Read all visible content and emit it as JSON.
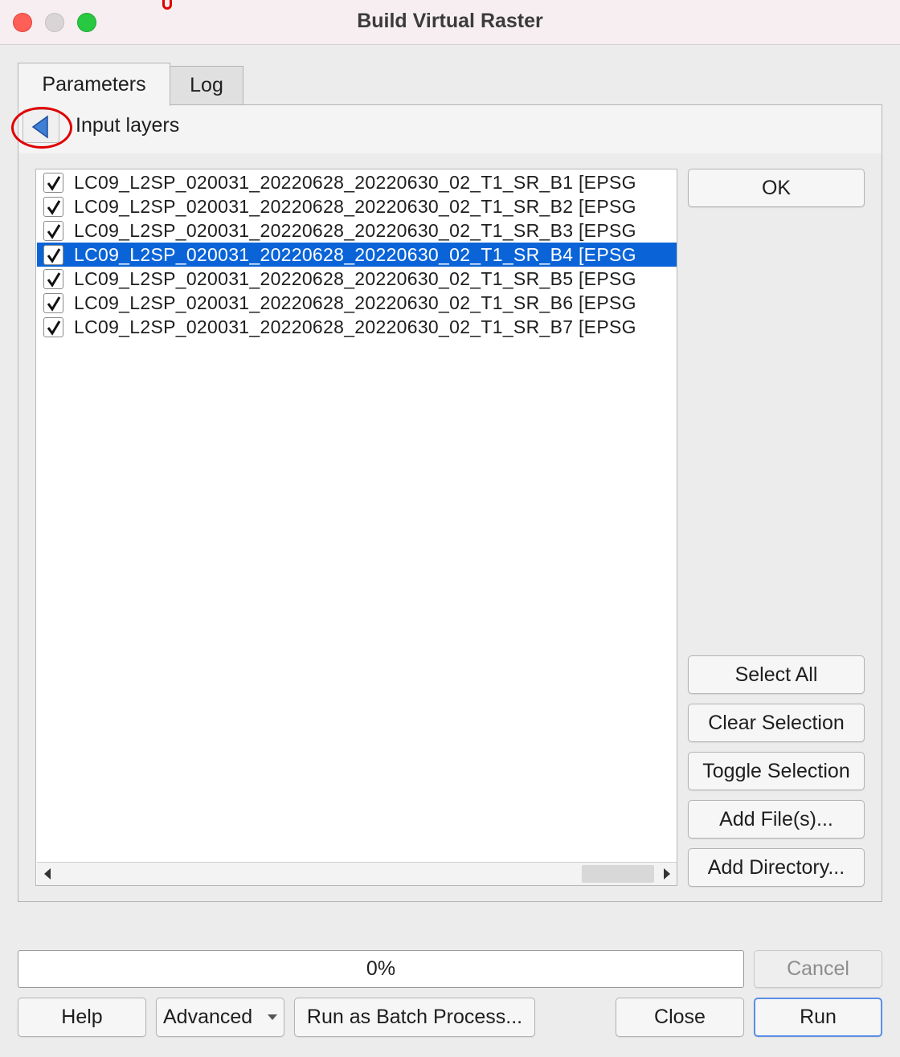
{
  "window": {
    "title": "Build Virtual Raster"
  },
  "tabs": [
    {
      "label": "Parameters"
    },
    {
      "label": "Log"
    }
  ],
  "header": {
    "label": "Input layers"
  },
  "layers": [
    {
      "label": "LC09_L2SP_020031_20220628_20220630_02_T1_SR_B1 [EPSG",
      "checked": true,
      "selected": false
    },
    {
      "label": "LC09_L2SP_020031_20220628_20220630_02_T1_SR_B2 [EPSG",
      "checked": true,
      "selected": false
    },
    {
      "label": "LC09_L2SP_020031_20220628_20220630_02_T1_SR_B3 [EPSG",
      "checked": true,
      "selected": false
    },
    {
      "label": "LC09_L2SP_020031_20220628_20220630_02_T1_SR_B4 [EPSG",
      "checked": true,
      "selected": true
    },
    {
      "label": "LC09_L2SP_020031_20220628_20220630_02_T1_SR_B5 [EPSG",
      "checked": true,
      "selected": false
    },
    {
      "label": "LC09_L2SP_020031_20220628_20220630_02_T1_SR_B6 [EPSG",
      "checked": true,
      "selected": false
    },
    {
      "label": "LC09_L2SP_020031_20220628_20220630_02_T1_SR_B7 [EPSG",
      "checked": true,
      "selected": false
    }
  ],
  "side_buttons": {
    "ok": "OK",
    "select_all": "Select All",
    "clear_selection": "Clear Selection",
    "toggle_selection": "Toggle Selection",
    "add_files": "Add File(s)...",
    "add_directory": "Add Directory..."
  },
  "progress": {
    "text": "0%",
    "value": 0
  },
  "bottom_buttons": {
    "cancel": "Cancel",
    "help": "Help",
    "advanced": "Advanced",
    "batch": "Run as Batch Process...",
    "close": "Close",
    "run": "Run"
  },
  "colors": {
    "selection": "#0a64d8",
    "annotation": "#e00000"
  }
}
